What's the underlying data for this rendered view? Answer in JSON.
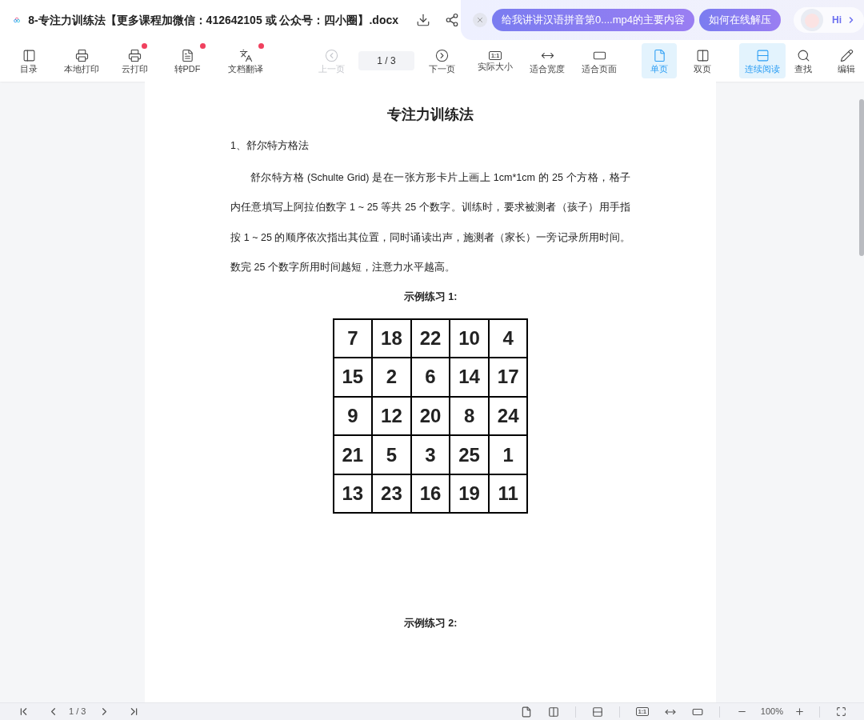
{
  "header": {
    "title": "8-专注力训练法【更多课程加微信：412642105 或 公众号：四小圈】.docx",
    "suggestions": [
      "给我讲讲汉语拼音第0....mp4的主要内容",
      "如何在线解压"
    ],
    "assistant_label": "Hi"
  },
  "toolbar": {
    "groups": [
      [
        {
          "kind": "tool",
          "label": "目录",
          "badge": false,
          "disabled": false,
          "selected": false
        },
        {
          "kind": "tool",
          "label": "本地打印",
          "badge": false,
          "disabled": false,
          "selected": false
        },
        {
          "kind": "tool",
          "label": "云打印",
          "badge": true,
          "disabled": false,
          "selected": false
        },
        {
          "kind": "tool",
          "label": "转PDF",
          "badge": true,
          "disabled": false,
          "selected": false
        },
        {
          "kind": "tool",
          "label": "文档翻译",
          "badge": true,
          "disabled": false,
          "selected": false
        }
      ],
      [
        {
          "kind": "tool",
          "label": "上一页",
          "badge": false,
          "disabled": true,
          "selected": false
        },
        {
          "kind": "pager",
          "value": "1 / 3"
        },
        {
          "kind": "tool",
          "label": "下一页",
          "badge": false,
          "disabled": false,
          "selected": false
        }
      ],
      [
        {
          "kind": "tool",
          "label": "实际大小",
          "icon_text": "1:1",
          "badge": false,
          "disabled": false,
          "selected": false
        },
        {
          "kind": "tool",
          "label": "适合宽度",
          "badge": false,
          "disabled": false,
          "selected": false
        },
        {
          "kind": "tool",
          "label": "适合页面",
          "badge": false,
          "disabled": false,
          "selected": false
        }
      ],
      [
        {
          "kind": "tool",
          "label": "单页",
          "badge": false,
          "disabled": false,
          "selected": true
        },
        {
          "kind": "tool",
          "label": "双页",
          "badge": false,
          "disabled": false,
          "selected": false
        }
      ],
      [
        {
          "kind": "tool",
          "label": "连续阅读",
          "badge": false,
          "disabled": false,
          "selected": true
        }
      ],
      [
        {
          "kind": "tool",
          "label": "查找",
          "badge": false,
          "disabled": false,
          "selected": false
        },
        {
          "kind": "tool",
          "label": "编辑",
          "badge": false,
          "disabled": false,
          "selected": false
        }
      ]
    ]
  },
  "document": {
    "title": "专注力训练法",
    "heading": "1、舒尔特方格法",
    "paragraph": "舒尔特方格 (Schulte Grid) 是在一张方形卡片上画上 1cm*1cm 的 25 个方格，格子内任意填写上阿拉伯数字 1 ~ 25 等共 25 个数字。训练时，要求被测者（孩子）用手指按 1 ~ 25 的顺序依次指出其位置，同时诵读出声，施测者（家长）一旁记录所用时间。数完 25 个数字所用时间越短，注意力水平越高。",
    "examples": [
      {
        "caption": "示例练习 1:",
        "grid": [
          [
            "7",
            "18",
            "22",
            "10",
            "4"
          ],
          [
            "15",
            "2",
            "6",
            "14",
            "17"
          ],
          [
            "9",
            "12",
            "20",
            "8",
            "24"
          ],
          [
            "21",
            "5",
            "3",
            "25",
            "1"
          ],
          [
            "13",
            "23",
            "16",
            "19",
            "11"
          ]
        ]
      },
      {
        "caption": "示例练习 2:"
      }
    ]
  },
  "status_bar": {
    "page": "1 / 3",
    "actual_size_icon": "1:1",
    "zoom": "100%"
  }
}
